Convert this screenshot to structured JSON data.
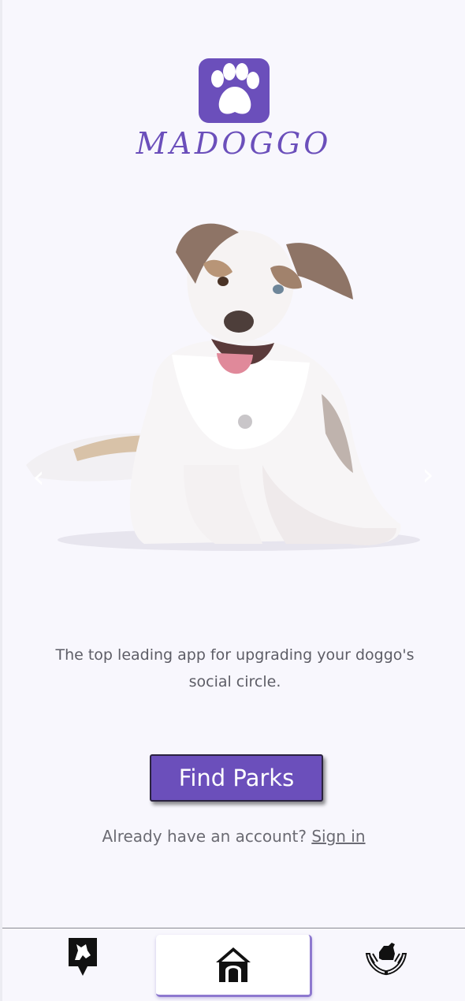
{
  "app": {
    "brand_name": "MADOGGO",
    "accent_color": "#6b4fbb"
  },
  "hero": {
    "image_subject": "australian-shepherd-puppy-lying-down"
  },
  "tagline": "The top leading app for upgrading your doggo's social circle.",
  "cta": {
    "label": "Find Parks"
  },
  "auth": {
    "prompt": "Already have an account?",
    "link_label": "Sign in"
  },
  "tabbar": {
    "items": [
      {
        "icon": "dog-park-pin-icon",
        "active": false
      },
      {
        "icon": "doghouse-icon",
        "active": true
      },
      {
        "icon": "dog-care-hands-icon",
        "active": false
      }
    ]
  },
  "carousel": {
    "prev_glyph": "‹",
    "next_glyph": "›"
  }
}
